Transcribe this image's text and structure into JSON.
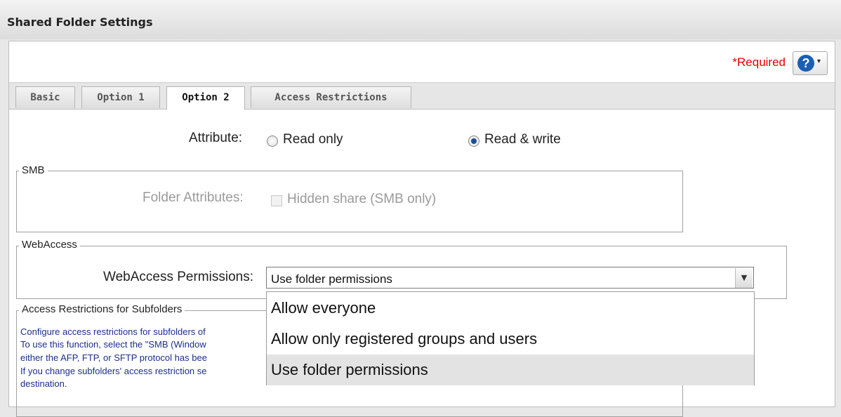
{
  "window": {
    "title": "Shared Folder Settings"
  },
  "header": {
    "required_label": "*Required",
    "help_icon": "question-circle-icon",
    "help_caret": "▾"
  },
  "tabs": [
    {
      "label": "Basic",
      "active": false
    },
    {
      "label": "Option 1",
      "active": false
    },
    {
      "label": "Option 2",
      "active": true
    },
    {
      "label": "Access Restrictions",
      "active": false
    }
  ],
  "attribute": {
    "label": "Attribute:",
    "options": [
      {
        "label": "Read only",
        "checked": false
      },
      {
        "label": "Read & write",
        "checked": true
      }
    ]
  },
  "smb": {
    "legend": "SMB",
    "folder_attributes_label": "Folder Attributes:",
    "hidden_share_label": "Hidden share (SMB only)",
    "hidden_share_checked": false
  },
  "webaccess": {
    "legend": "WebAccess",
    "permissions_label": "WebAccess Permissions:",
    "selected_value": "Use folder permissions",
    "dropdown_open": true,
    "options": [
      {
        "label": "Allow everyone",
        "highlighted": false
      },
      {
        "label": "Allow only registered groups and users",
        "highlighted": false
      },
      {
        "label": "Use folder permissions",
        "highlighted": true
      }
    ]
  },
  "subfolders": {
    "legend": "Access Restrictions for Subfolders",
    "description_lines": [
      "Configure access restrictions for subfolders of",
      "To use this function, select the \"SMB (Window",
      "either the AFP, FTP, or SFTP protocol has bee",
      "If you change subfolders' access restriction se",
      "destination."
    ]
  },
  "colors": {
    "required": "#e00000",
    "help_blue": "#1a5fb4",
    "description": "#1c2e8c"
  }
}
